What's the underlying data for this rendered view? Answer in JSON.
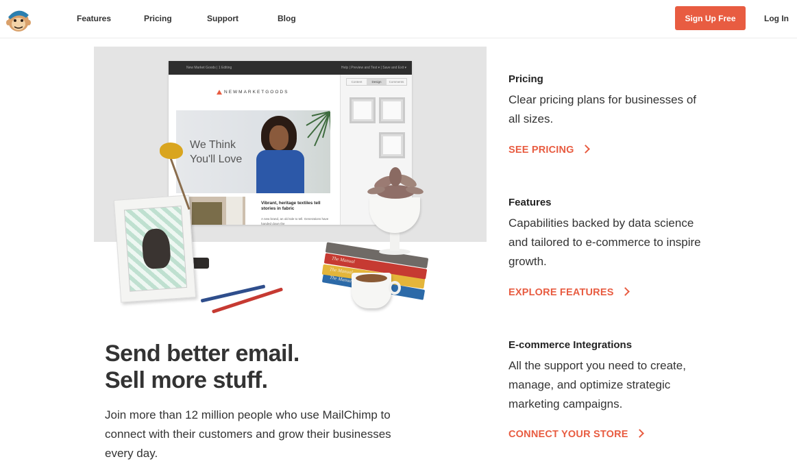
{
  "nav": {
    "links": [
      "Features",
      "Pricing",
      "Support",
      "Blog"
    ],
    "signup_label": "Sign Up Free",
    "login_label": "Log In"
  },
  "editor": {
    "bar_left": "New Market Goods  |  1 Editing",
    "bar_right": "Help  |  Preview and Test ▾  |  Save and Exit ▾",
    "tabs": [
      "Content",
      "Design",
      "Comments"
    ],
    "brand": "NEWMARKETGOODS",
    "headline_line1": "We Think",
    "headline_line2": "You'll Love",
    "sub_title": "Vibrant, heritage textiles tell stories in fabric",
    "sub_body": "A new brand, an old tale to tell. Generations have handed down the"
  },
  "books": [
    "The Manual",
    "The Manual",
    "The Manual"
  ],
  "hero": {
    "headline_line1": "Send better email.",
    "headline_line2": "Sell more stuff.",
    "lede": "Join more than 12 million people who use MailChimp to connect with their customers and grow their businesses every day."
  },
  "features": [
    {
      "title": "Pricing",
      "text": "Clear pricing plans for businesses of all sizes.",
      "link": "SEE PRICING"
    },
    {
      "title": "Features",
      "text": "Capabilities backed by data science and tailored to e-commerce to inspire growth.",
      "link": "EXPLORE FEATURES"
    },
    {
      "title": "E-commerce Integrations",
      "text": "All the support you need to create, manage, and optimize strategic marketing campaigns.",
      "link": "CONNECT YOUR STORE"
    }
  ],
  "colors": {
    "accent": "#e85c41",
    "text": "#333333",
    "hero_bg": "#e4e4e4"
  },
  "icons": [
    "freddie-logo-icon",
    "chevron-right-icon"
  ]
}
